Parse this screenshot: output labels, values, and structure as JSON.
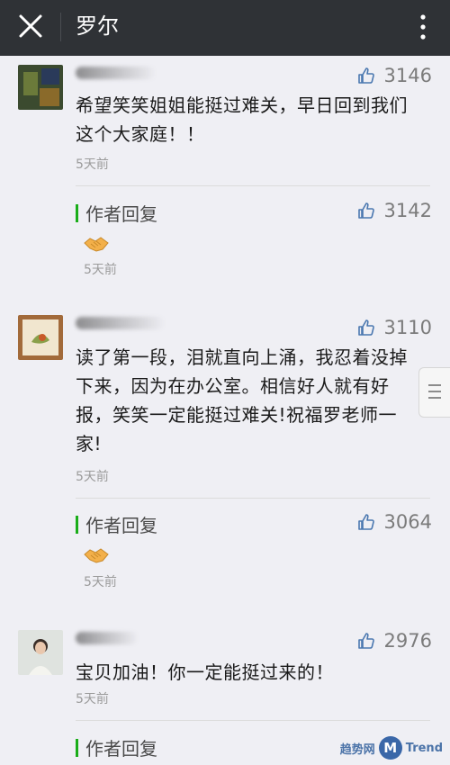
{
  "topbar": {
    "title": "罗尔"
  },
  "comments": [
    {
      "likes": "3146",
      "text": "希望笑笑姐姐能挺过难关，早日回到我们这个大家庭！！",
      "time": "5天前",
      "reply": {
        "label": "作者回复",
        "likes": "3142",
        "time": "5天前",
        "emoji": "handshake"
      }
    },
    {
      "likes": "3110",
      "text": "读了第一段，泪就直向上涌，我忍着没掉下来，因为在办公室。相信好人就有好报，笑笑一定能挺过难关!祝福罗老师一家!",
      "time": "5天前",
      "reply": {
        "label": "作者回复",
        "likes": "3064",
        "time": "5天前",
        "emoji": "handshake"
      }
    },
    {
      "likes": "2976",
      "text": "宝贝加油！你一定能挺过来的！",
      "time": "5天前",
      "reply": {
        "label": "作者回复"
      }
    }
  ],
  "watermark": {
    "text1": "趋势网",
    "logo": "M",
    "text2": "Trend"
  },
  "colors": {
    "topbar": "#2f3236",
    "background": "#efeff4",
    "reply_bar": "#1aad19",
    "like": "#7b7b7b"
  }
}
